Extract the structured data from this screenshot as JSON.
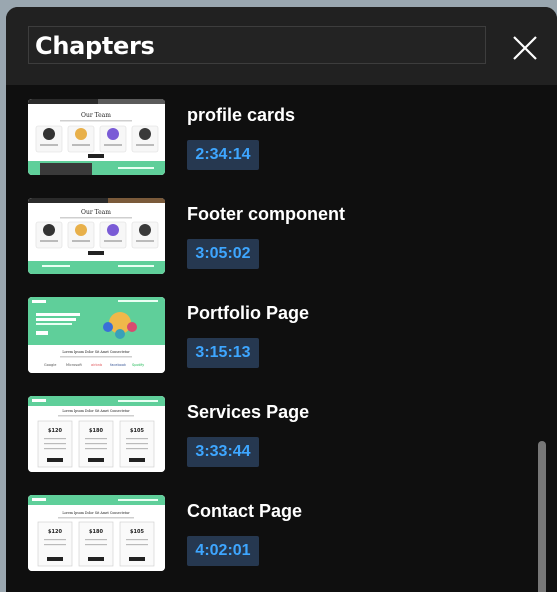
{
  "panel": {
    "title": "Chapters"
  },
  "chapters": [
    {
      "title": "profile cards",
      "time": "2:34:14"
    },
    {
      "title": "Footer component",
      "time": "3:05:02"
    },
    {
      "title": "Portfolio Page",
      "time": "3:15:13"
    },
    {
      "title": "Services Page",
      "time": "3:33:44"
    },
    {
      "title": "Contact Page",
      "time": "4:02:01"
    }
  ],
  "thumbnails": {
    "team_heading": "Our Team",
    "portfolio_heading": "Lorem Ipsum Dolor Sit Amet Consectetur",
    "brands": [
      "Google",
      "Microsoft",
      "airbnb",
      "facebook",
      "Spotify"
    ],
    "prices": [
      "$120",
      "$180",
      "$105"
    ],
    "accent_color": "#5fcf9a"
  },
  "icons": {
    "close": "close-icon"
  }
}
